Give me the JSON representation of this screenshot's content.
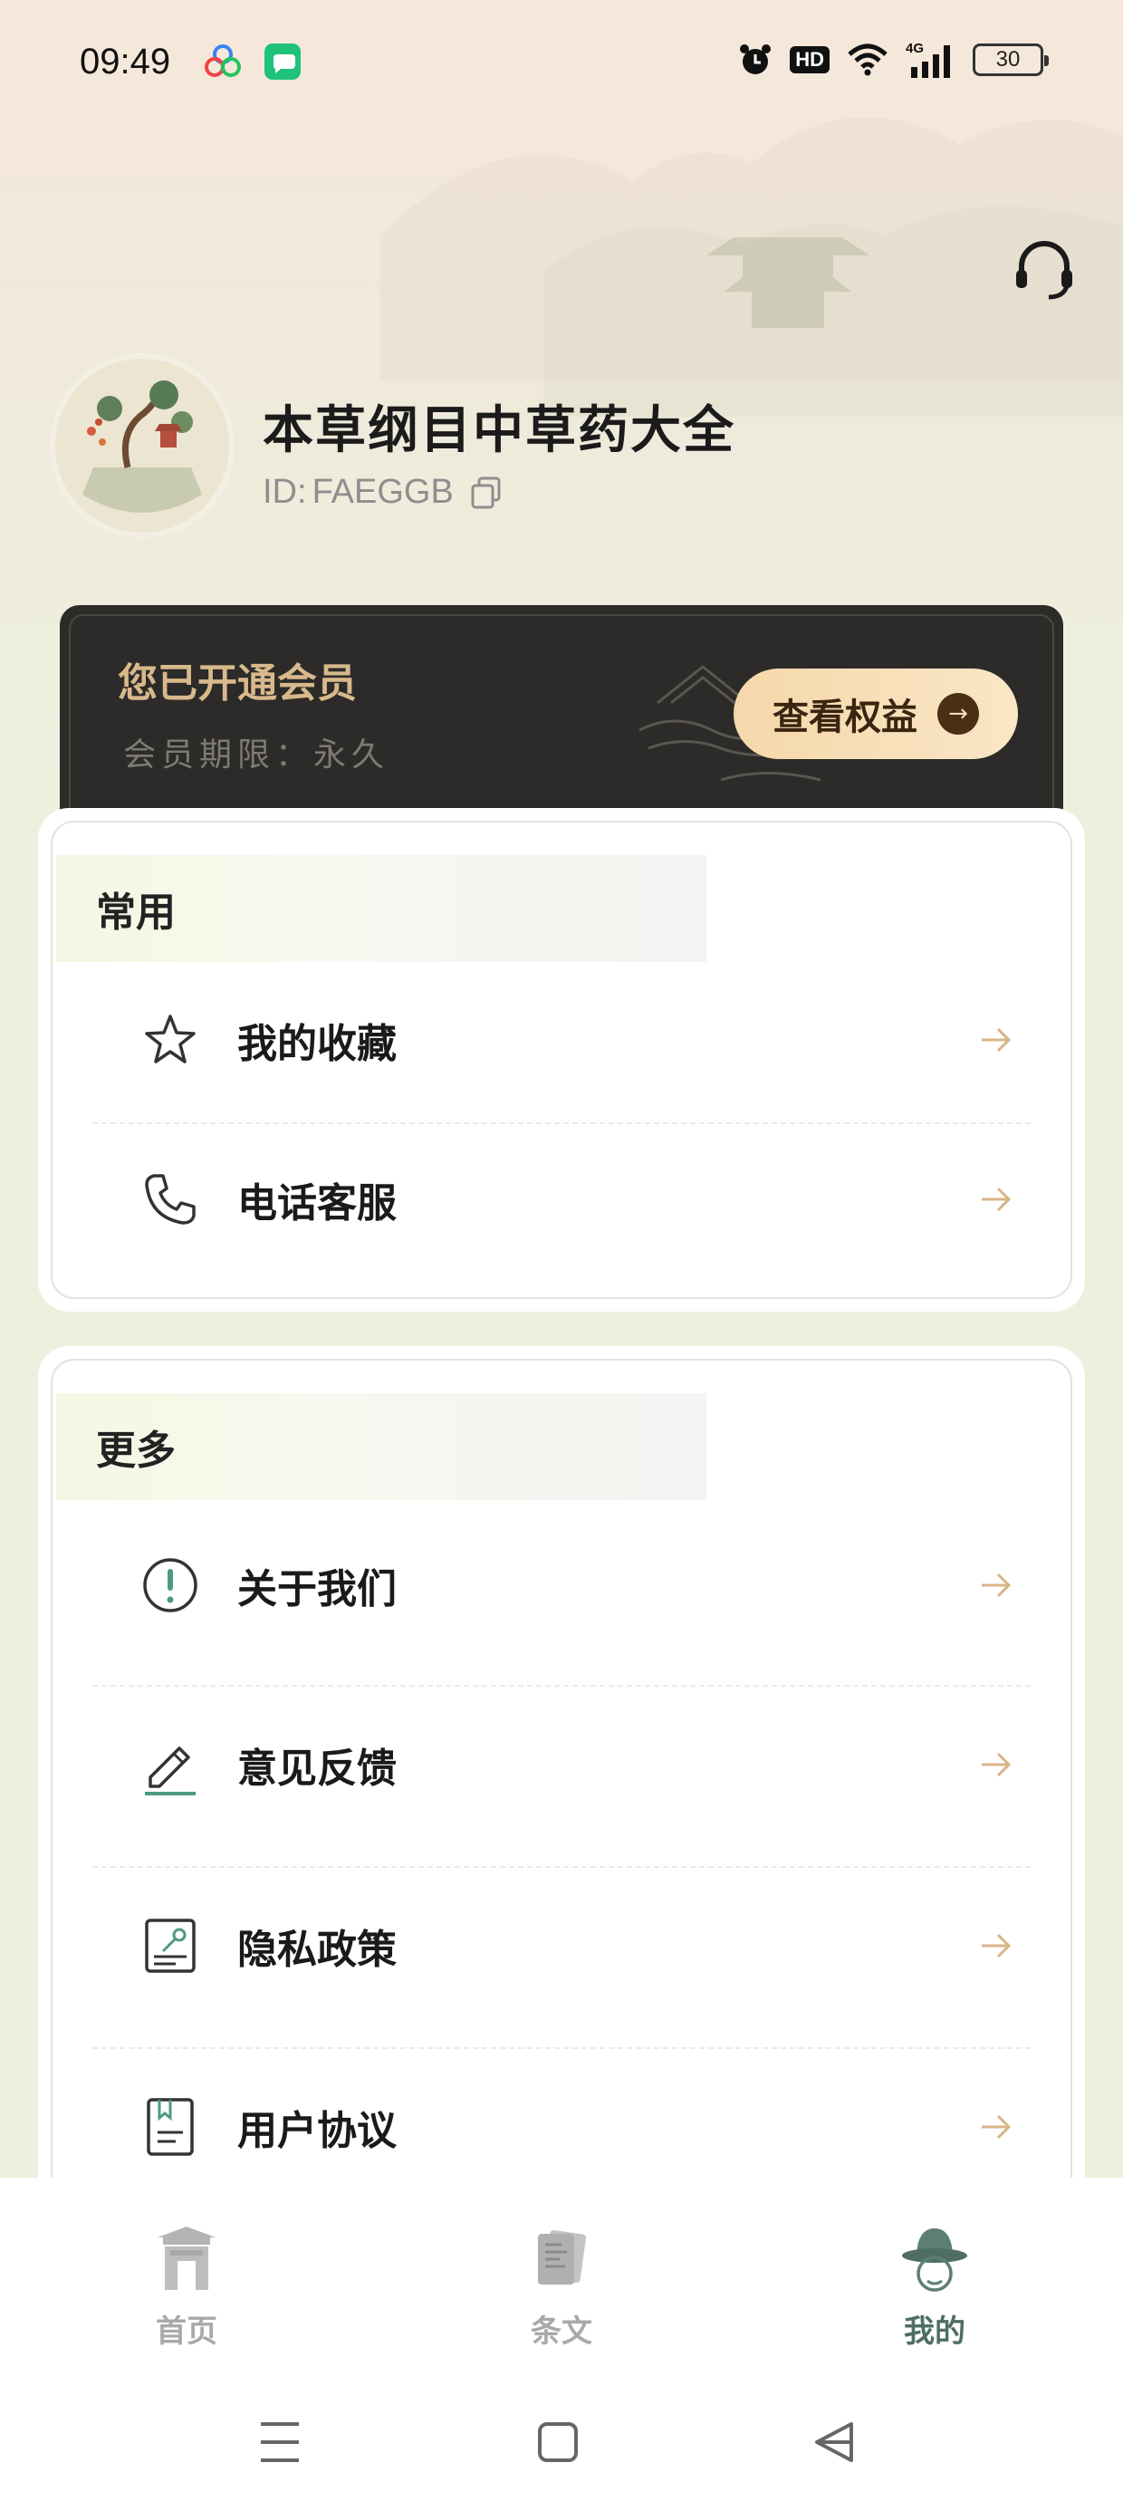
{
  "status_bar": {
    "time": "09:49",
    "app_icons": [
      "colorful-cluster-icon",
      "green-chat-icon"
    ],
    "indicators": [
      "alarm-icon",
      "hd-icon",
      "wifi-icon",
      "cellular-4g-icon"
    ],
    "hd_label": "HD",
    "network_label": "4G",
    "battery": "30"
  },
  "header": {
    "support_icon": "headset-icon"
  },
  "profile": {
    "name": "本草纲目中草药大全",
    "id_label": "ID:",
    "id_value": "FAEGGB",
    "copy_icon": "copy-icon"
  },
  "membership": {
    "title": "您已开通会员",
    "term": "会员期限：永久",
    "button_label": "查看权益",
    "button_arrow": "→"
  },
  "sections": {
    "common": {
      "title": "常用",
      "items": [
        {
          "label": "我的收藏",
          "icon": "star-icon"
        },
        {
          "label": "电话客服",
          "icon": "phone-icon"
        }
      ]
    },
    "more": {
      "title": "更多",
      "items": [
        {
          "label": "关于我们",
          "icon": "info-circle-icon"
        },
        {
          "label": "意见反馈",
          "icon": "pencil-icon"
        },
        {
          "label": "隐私政策",
          "icon": "privacy-key-icon"
        },
        {
          "label": "用户协议",
          "icon": "bookmark-document-icon"
        }
      ]
    }
  },
  "bottom_nav": {
    "items": [
      {
        "label": "首页",
        "icon": "gate-icon",
        "active": false
      },
      {
        "label": "条文",
        "icon": "cards-icon",
        "active": false
      },
      {
        "label": "我的",
        "icon": "scholar-hat-icon",
        "active": true
      }
    ]
  },
  "colors": {
    "accent_green": "#4e6e62",
    "gold": "#d8b98c",
    "card_dark": "#2c2b29",
    "arrow_gold": "#d9b486"
  }
}
